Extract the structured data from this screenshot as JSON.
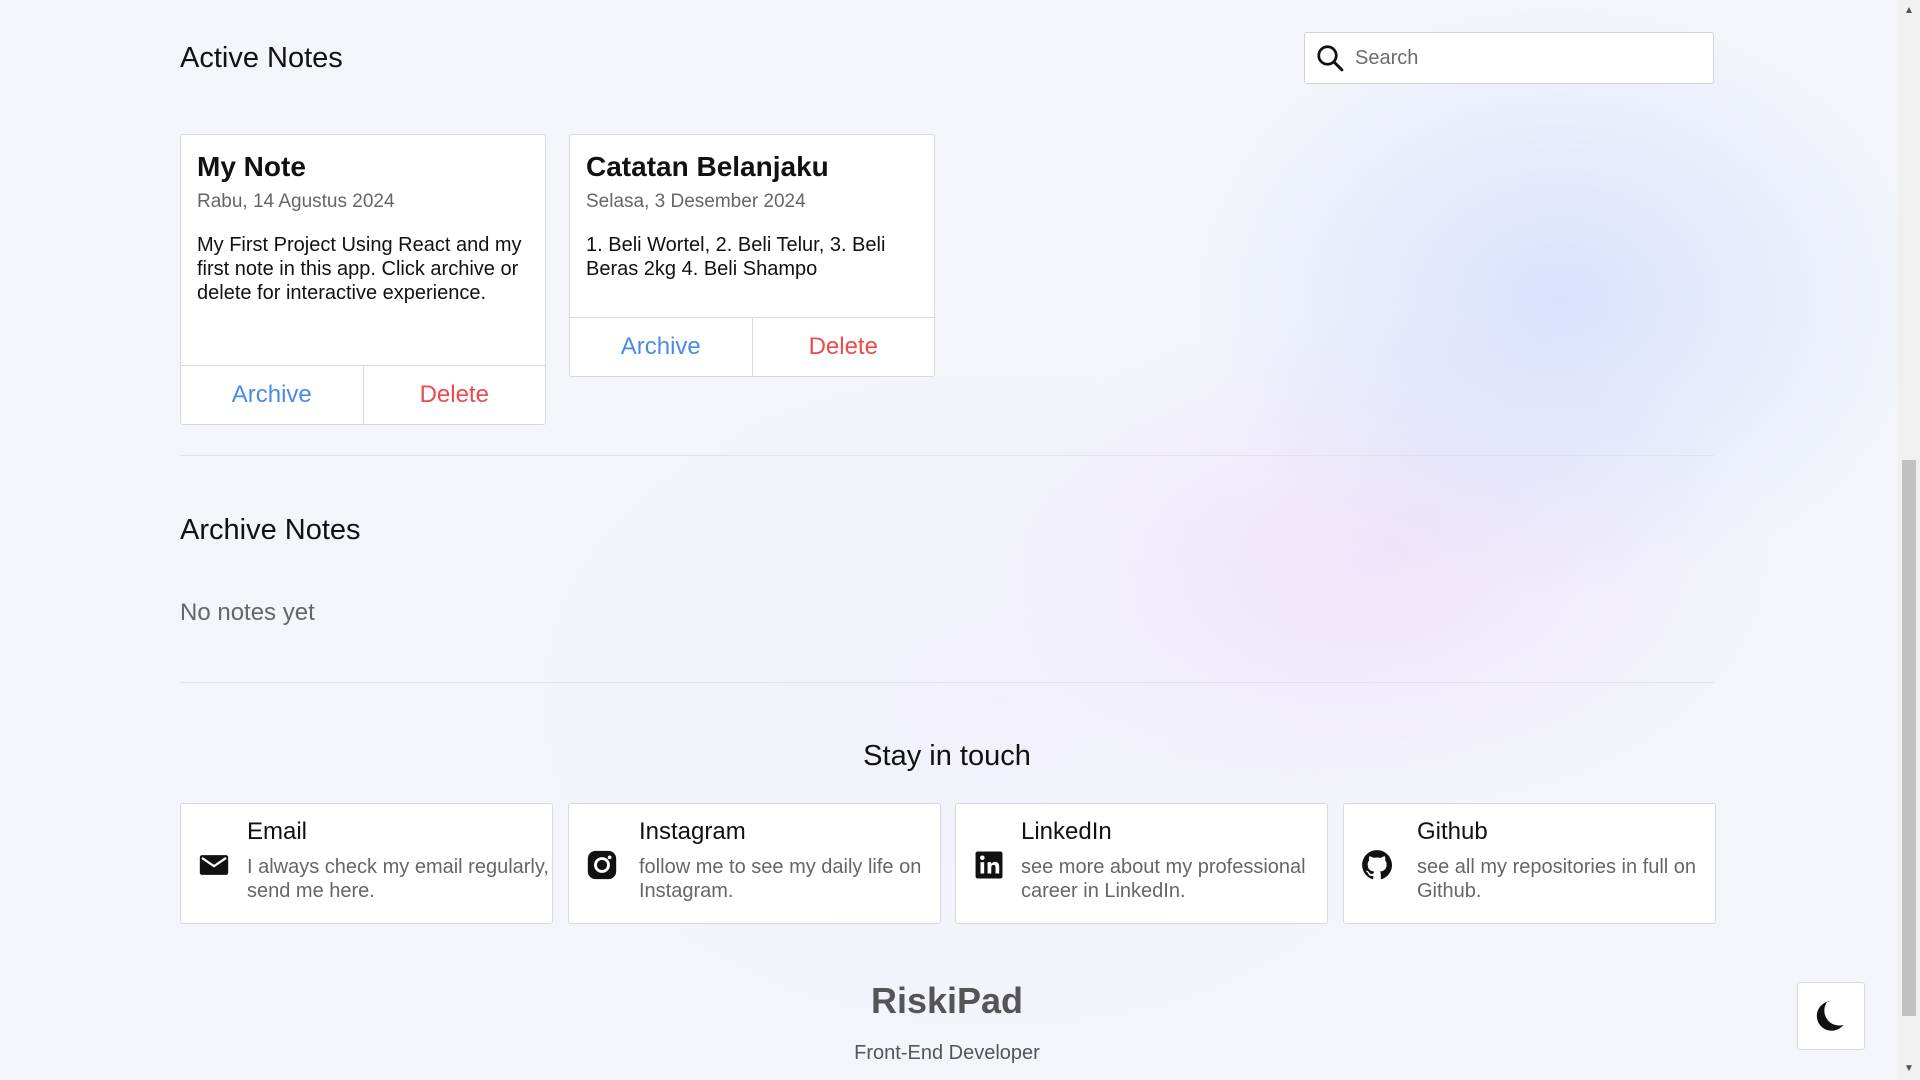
{
  "active_section": {
    "title": "Active Notes"
  },
  "search": {
    "placeholder": "Search",
    "value": ""
  },
  "notes": [
    {
      "title": "My Note",
      "date": "Rabu, 14 Agustus 2024",
      "body": "My First Project Using React and my first note in this app. Click archive or delete for interactive experience.",
      "archive_label": "Archive",
      "delete_label": "Delete"
    },
    {
      "title": "Catatan Belanjaku",
      "date": "Selasa, 3 Desember 2024",
      "body": "1. Beli Wortel, 2. Beli Telur, 3. Beli Beras 2kg 4. Beli Shampo",
      "archive_label": "Archive",
      "delete_label": "Delete"
    }
  ],
  "archive_section": {
    "title": "Archive Notes",
    "empty_text": "No notes yet"
  },
  "contact": {
    "title": "Stay in touch",
    "items": [
      {
        "name": "Email",
        "description": "I always check my email regularly, send me here.",
        "icon": "email-icon"
      },
      {
        "name": "Instagram",
        "description": "follow me to see my daily life on Instagram.",
        "icon": "instagram-icon"
      },
      {
        "name": "LinkedIn",
        "description": "see more about my professional career in LinkedIn.",
        "icon": "linkedin-icon"
      },
      {
        "name": "Github",
        "description": "see all my repositories in full on Github.",
        "icon": "github-icon"
      }
    ]
  },
  "footer": {
    "brand": "RiskiPad",
    "role": "Front-End Developer"
  },
  "theme_toggle": {
    "icon": "moon-icon"
  },
  "colors": {
    "archive": "#4a8bea",
    "delete": "#ee4a4a",
    "muted_text": "#666666"
  }
}
